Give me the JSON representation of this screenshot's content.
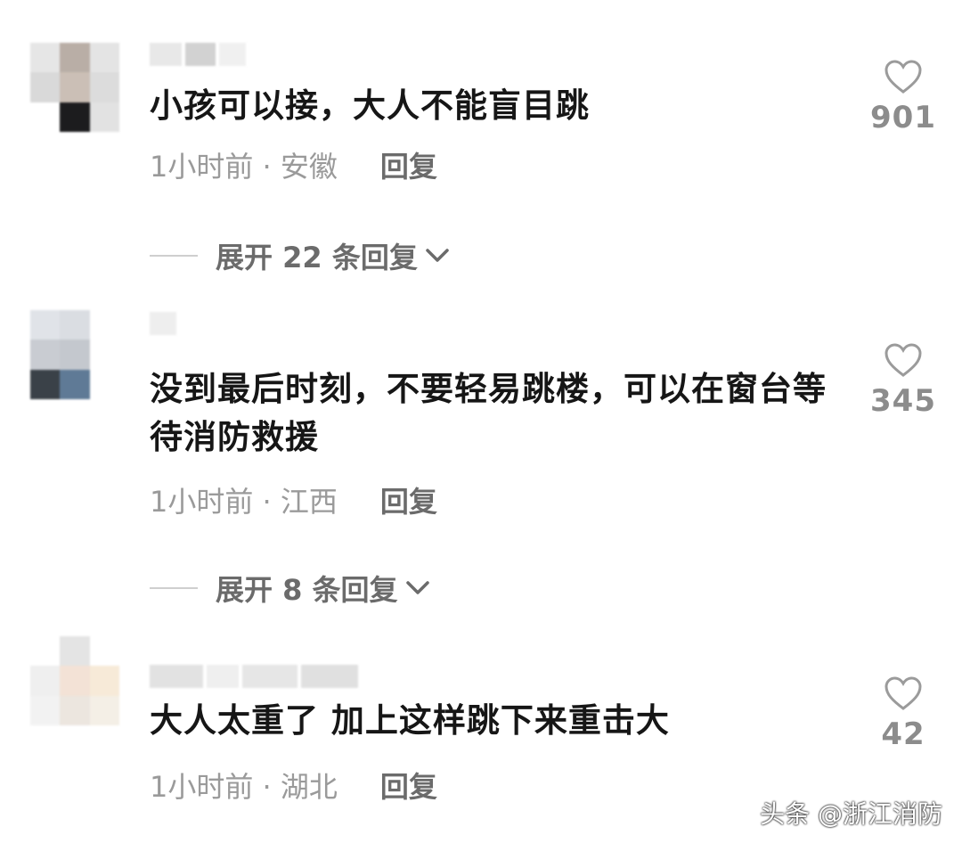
{
  "comments": [
    {
      "text": "小孩可以接，大人不能盲目跳",
      "time": "1小时前 · 安徽",
      "reply_label": "回复",
      "expand_label": "展开 22 条回复",
      "likes": "901"
    },
    {
      "text": "没到最后时刻，不要轻易跳楼，可以在窗台等待消防救援",
      "time": "1小时前 · 江西",
      "reply_label": "回复",
      "expand_label": "展开 8 条回复",
      "likes": "345"
    },
    {
      "text": "大人太重了 加上这样跳下来重击大",
      "time": "1小时前 · 湖北",
      "reply_label": "回复",
      "likes": "42"
    }
  ],
  "icons": {
    "like": "heart-outline-icon",
    "expand": "chevron-down-icon"
  },
  "watermark": "头条 @浙江消防",
  "colors": {
    "text": "#161616",
    "meta": "#9a9a9a",
    "secondary": "#6b6b6b",
    "like_count": "#8c8c8c"
  }
}
